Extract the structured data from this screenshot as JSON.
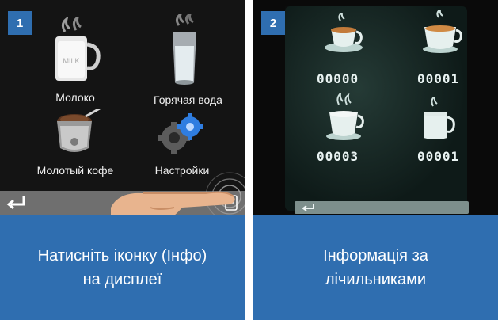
{
  "panel1": {
    "step": "1",
    "menu": [
      {
        "label": "Молоко",
        "icon": "milk-cup-icon"
      },
      {
        "label": "Горячая вода",
        "icon": "hot-water-glass-icon"
      },
      {
        "label": "Молотый кофе",
        "icon": "ground-coffee-icon"
      },
      {
        "label": "Настройки",
        "icon": "settings-gears-icon"
      }
    ],
    "caption_line1": "Натисніть іконку (Інфо)",
    "caption_line2": "на дисплеї"
  },
  "panel2": {
    "step": "2",
    "counters": [
      "00000",
      "00001",
      "00003",
      "00001"
    ],
    "caption_line1": "Інформація за",
    "caption_line2": "лічильниками"
  },
  "colors": {
    "accent_blue": "#2f6eb0",
    "screen_dark": "#141414",
    "bar_gray": "#6f6f6f"
  }
}
